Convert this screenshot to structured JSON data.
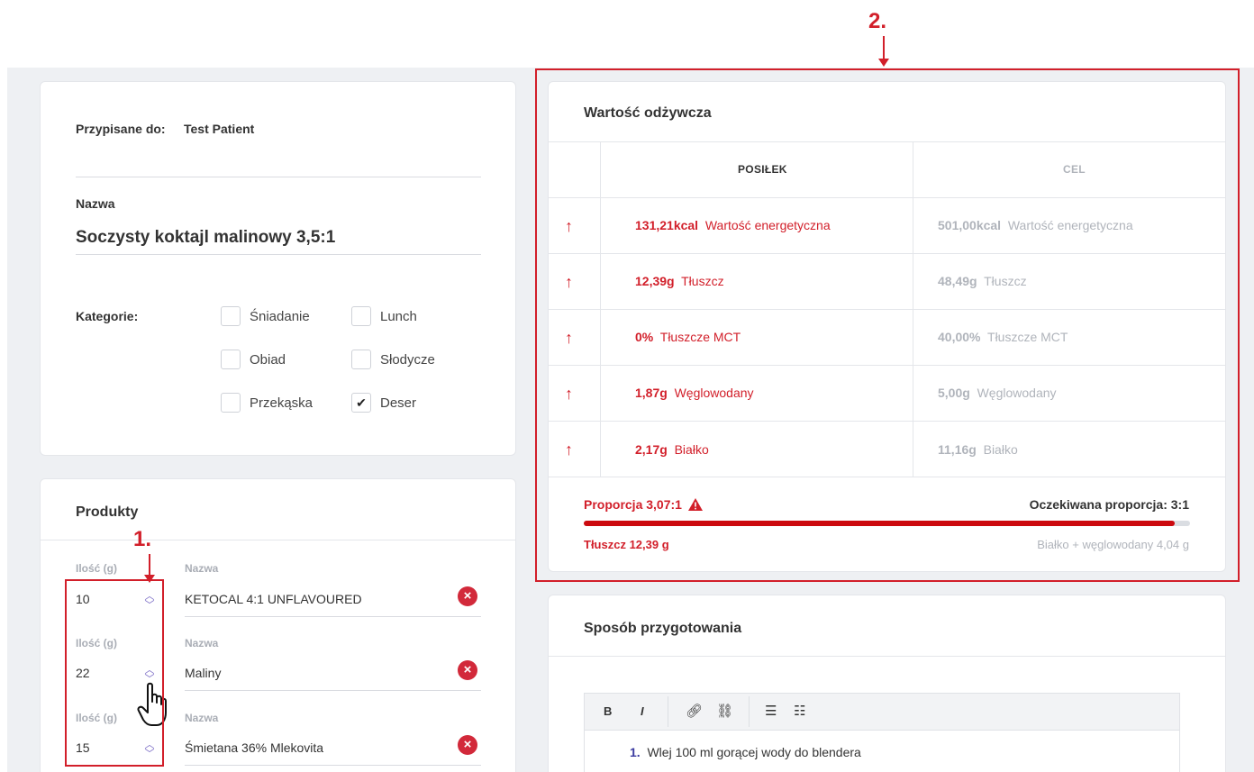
{
  "annotations": {
    "label1": "1.",
    "label2": "2."
  },
  "details": {
    "assigned_label": "Przypisane do:",
    "assigned_value": "Test Patient",
    "name_label": "Nazwa",
    "name_value": "Soczysty koktajl malinowy 3,5:1",
    "categories_label": "Kategorie:",
    "categories": [
      {
        "label": "Śniadanie",
        "checked": false
      },
      {
        "label": "Lunch",
        "checked": false
      },
      {
        "label": "Obiad",
        "checked": false
      },
      {
        "label": "Słodycze",
        "checked": false
      },
      {
        "label": "Przekąska",
        "checked": false
      },
      {
        "label": "Deser",
        "checked": true
      }
    ],
    "check_mark": "✔"
  },
  "products": {
    "title": "Produkty",
    "qty_header": "Ilość (g)",
    "name_header": "Nazwa",
    "items": [
      {
        "qty": "10",
        "name": "KETOCAL 4:1 UNFLAVOURED"
      },
      {
        "qty": "22",
        "name": "Maliny"
      },
      {
        "qty": "15",
        "name": "Śmietana 36% Mlekovita"
      }
    ]
  },
  "nutrition": {
    "title": "Wartość odżywcza",
    "col_meal": "POSIŁEK",
    "col_goal": "CEL",
    "rows": [
      {
        "meal_value": "131,21kcal",
        "meal_label": "Wartość energetyczna",
        "goal_value": "501,00kcal",
        "goal_label": "Wartość energetyczna"
      },
      {
        "meal_value": "12,39g",
        "meal_label": "Tłuszcz",
        "goal_value": "48,49g",
        "goal_label": "Tłuszcz"
      },
      {
        "meal_value": "0%",
        "meal_label": "Tłuszcze MCT",
        "goal_value": "40,00%",
        "goal_label": "Tłuszcze MCT"
      },
      {
        "meal_value": "1,87g",
        "meal_label": "Węglowodany",
        "goal_value": "5,00g",
        "goal_label": "Węglowodany"
      },
      {
        "meal_value": "2,17g",
        "meal_label": "Białko",
        "goal_value": "11,16g",
        "goal_label": "Białko"
      }
    ],
    "up_arrow": "↑",
    "ratio_label": "Proporcja 3,07:1",
    "expected_ratio": "Oczekiwana proporcja: 3:1",
    "ratio_fill_fraction": 0.975,
    "fat_label": "Tłuszcz 12,39 g",
    "other_label": "Białko + węglowodany 4,04 g",
    "accent_color": "#d21f2a"
  },
  "preparation": {
    "title": "Sposób przygotowania",
    "toolbar": [
      "B",
      "I",
      "link",
      "unlink",
      "bulleted-list",
      "numbered-list"
    ],
    "steps": [
      {
        "num": "1.",
        "text": "Wlej 100 ml gorącej wody do blendera"
      }
    ]
  }
}
